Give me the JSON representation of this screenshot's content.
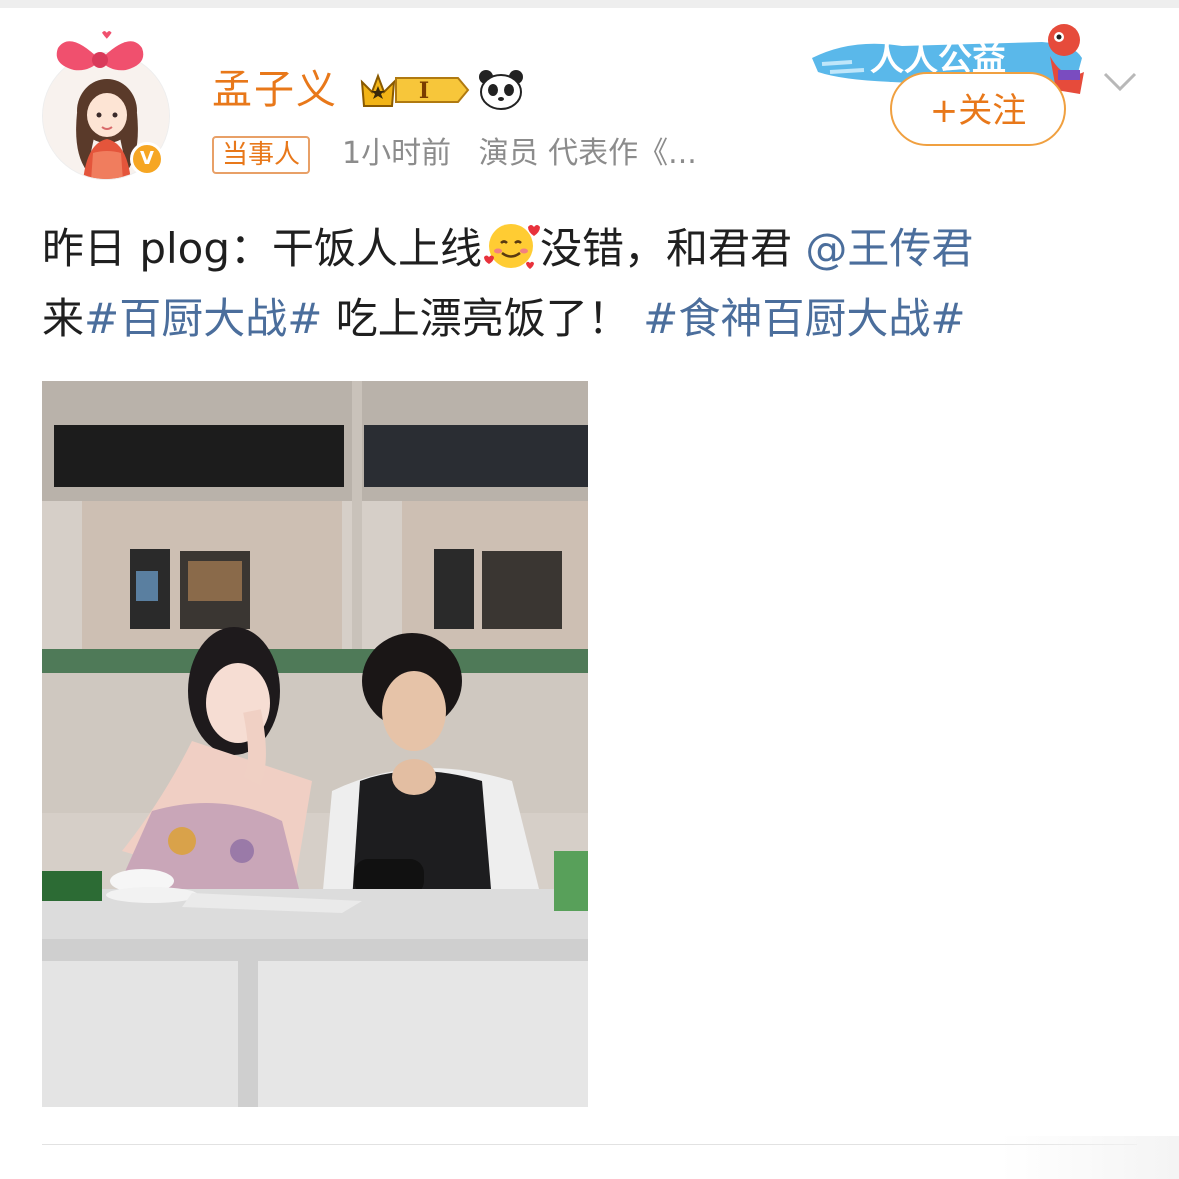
{
  "user": {
    "name": "孟子义",
    "level_badge": "I",
    "tag": "当事人",
    "time": "1小时前",
    "description": "演员 代表作《..."
  },
  "header": {
    "charity_label": "人人公益",
    "follow_label": "+关注"
  },
  "post": {
    "text_part1": "昨日 plog：干饭人上线",
    "text_part2": "没错，和君君 ",
    "mention": "@王传君",
    "text_part3": "来",
    "hashtag1": "#百厨大战#",
    "text_part4": " 吃上漂亮饭了！",
    "hashtag2": "#食神百厨大战#"
  },
  "colors": {
    "username": "#e8781a",
    "link": "#4b6e9c",
    "meta": "#8c8c8c",
    "text": "#1f1f1f"
  },
  "icons": [
    "v-verified-icon",
    "crown-level-icon",
    "panda-icon",
    "chevron-down-icon",
    "smiling-hearts-emoji"
  ]
}
